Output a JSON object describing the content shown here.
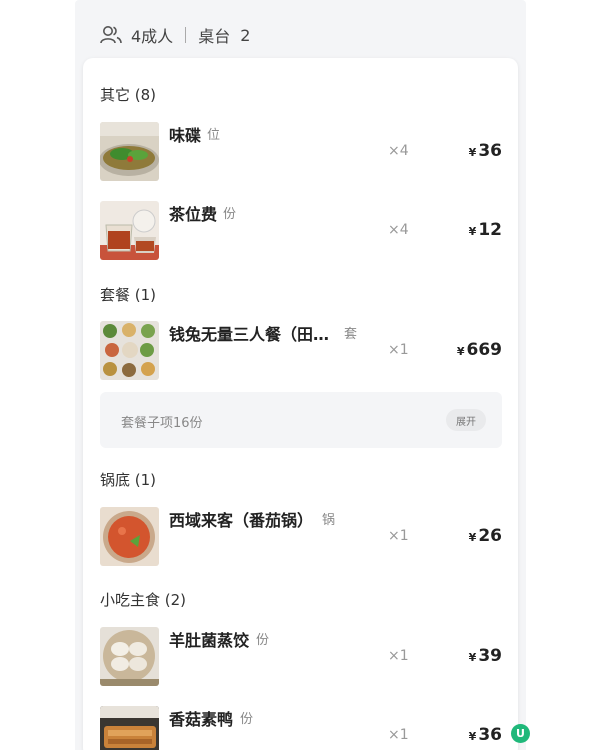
{
  "header": {
    "guests": "4成人",
    "table_label": "桌台",
    "table_no": "2"
  },
  "sections": [
    {
      "title": "其它 (8)",
      "items": [
        {
          "name": "味碟",
          "unit": "位",
          "qty": "×4",
          "yen": "¥",
          "price": "36",
          "thumb": "sauce-dish"
        },
        {
          "name": "茶位费",
          "unit": "份",
          "qty": "×4",
          "yen": "¥",
          "price": "12",
          "thumb": "tea"
        }
      ]
    },
    {
      "title": "套餐 (1)",
      "items": [
        {
          "name": "钱兔无量三人餐（田…",
          "unit": "套",
          "qty": "×1",
          "yen": "¥",
          "price": "669",
          "thumb": "set-meal"
        }
      ],
      "combo": {
        "label": "套餐子项16份",
        "expand": "展开"
      }
    },
    {
      "title": "锅底 (1)",
      "items": [
        {
          "name": "西域来客（番茄锅）",
          "unit": "锅",
          "qty": "×1",
          "yen": "¥",
          "price": "26",
          "thumb": "tomato-pot"
        }
      ]
    },
    {
      "title": "小吃主食 (2)",
      "items": [
        {
          "name": "羊肚菌蒸饺",
          "unit": "份",
          "qty": "×1",
          "yen": "¥",
          "price": "39",
          "thumb": "dumplings"
        },
        {
          "name": "香菇素鸭",
          "unit": "份",
          "qty": "×1",
          "yen": "¥",
          "price": "36",
          "thumb": "mushroom-duck"
        }
      ]
    }
  ],
  "badge": {
    "text": "U",
    "color": "#1fb87a"
  }
}
